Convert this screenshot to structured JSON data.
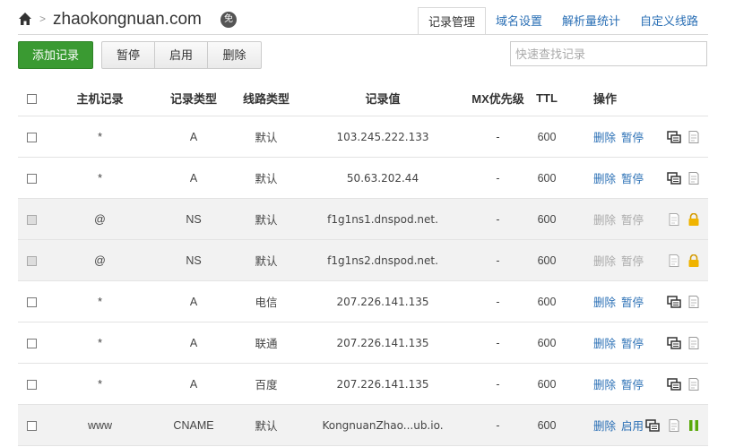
{
  "header": {
    "domain": "zhaokongnuan.com",
    "badge": "免",
    "tabs": [
      "记录管理",
      "域名设置",
      "解析量统计",
      "自定义线路"
    ]
  },
  "toolbar": {
    "add_label": "添加记录",
    "pause_label": "暂停",
    "enable_label": "启用",
    "delete_label": "删除",
    "search_placeholder": "快速查找记录"
  },
  "table": {
    "headers": {
      "host": "主机记录",
      "type": "记录类型",
      "line": "线路类型",
      "value": "记录值",
      "mx": "MX优先级",
      "ttl": "TTL",
      "ops": "操作"
    },
    "rows": [
      {
        "host": "*",
        "type": "A",
        "line": "默认",
        "value": "103.245.222.133",
        "mx": "-",
        "ttl": "600",
        "op1": "删除",
        "op2": "暂停"
      },
      {
        "host": "*",
        "type": "A",
        "line": "默认",
        "value": "50.63.202.44",
        "mx": "-",
        "ttl": "600",
        "op1": "删除",
        "op2": "暂停"
      },
      {
        "host": "@",
        "type": "NS",
        "line": "默认",
        "value": "f1g1ns1.dnspod.net.",
        "mx": "-",
        "ttl": "600",
        "op1": "删除",
        "op2": "暂停"
      },
      {
        "host": "@",
        "type": "NS",
        "line": "默认",
        "value": "f1g1ns2.dnspod.net.",
        "mx": "-",
        "ttl": "600",
        "op1": "删除",
        "op2": "暂停"
      },
      {
        "host": "*",
        "type": "A",
        "line": "电信",
        "value": "207.226.141.135",
        "mx": "-",
        "ttl": "600",
        "op1": "删除",
        "op2": "暂停"
      },
      {
        "host": "*",
        "type": "A",
        "line": "联通",
        "value": "207.226.141.135",
        "mx": "-",
        "ttl": "600",
        "op1": "删除",
        "op2": "暂停"
      },
      {
        "host": "*",
        "type": "A",
        "line": "百度",
        "value": "207.226.141.135",
        "mx": "-",
        "ttl": "600",
        "op1": "删除",
        "op2": "暂停"
      },
      {
        "host": "www",
        "type": "CNAME",
        "line": "默认",
        "value": "KongnuanZhao...ub.io.",
        "mx": "-",
        "ttl": "600",
        "op1": "删除",
        "op2": "启用"
      }
    ]
  },
  "colors": {
    "accent": "#2a6fb5",
    "add_button": "#3a9a32",
    "lock": "#f0b400",
    "paused": "#5aa90a"
  }
}
